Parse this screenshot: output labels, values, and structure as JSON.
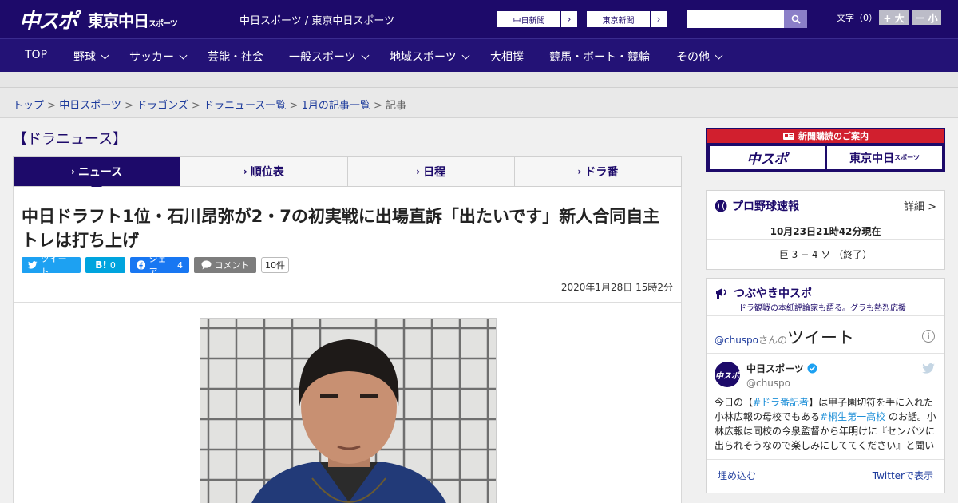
{
  "header": {
    "logo_primary": "中スポ",
    "logo_secondary": "東京中日",
    "logo_secondary_small": "スポーツ",
    "site_name": "中日スポーツ / 東京中日スポーツ",
    "ext_links": [
      {
        "label": "中日新聞"
      },
      {
        "label": "東京新聞"
      }
    ],
    "search_placeholder": "",
    "font_size_label": "文字（0）",
    "font_larger": "+ 大",
    "font_smaller": "ー 小"
  },
  "nav": [
    {
      "label": "TOP",
      "dropdown": false
    },
    {
      "label": "野球",
      "dropdown": true
    },
    {
      "label": "サッカー",
      "dropdown": true
    },
    {
      "label": "芸能・社会",
      "dropdown": false
    },
    {
      "label": "一般スポーツ",
      "dropdown": true
    },
    {
      "label": "地域スポーツ",
      "dropdown": true
    },
    {
      "label": "大相撲",
      "dropdown": false
    },
    {
      "label": "競馬・ボート・競輪",
      "dropdown": false
    },
    {
      "label": "その他",
      "dropdown": true
    }
  ],
  "breadcrumb": [
    {
      "label": "トップ"
    },
    {
      "label": "中日スポーツ"
    },
    {
      "label": "ドラゴンズ"
    },
    {
      "label": "ドラニュース一覧"
    },
    {
      "label": "1月の記事一覧"
    },
    {
      "label": "記事"
    }
  ],
  "section_title": "【ドラニュース】",
  "tabs": [
    {
      "label": "ニュース",
      "active": true
    },
    {
      "label": "順位表",
      "active": false
    },
    {
      "label": "日程",
      "active": false
    },
    {
      "label": "ドラ番",
      "active": false
    }
  ],
  "article": {
    "headline": "中日ドラフト1位・石川昂弥が2・7の初実戦に出場直訴「出たいです」新人合同自主トレは打ち上げ",
    "share": {
      "tweet": "ツイート",
      "hatena": "B!",
      "hatena_count": "0",
      "facebook": "シェア",
      "facebook_count": "4",
      "comment": "コメント",
      "comment_count": "10件"
    },
    "date": "2020年1月28日 15時2分"
  },
  "sidebar": {
    "ad_title": "新聞購読のご案内",
    "ad_left": "中スポ",
    "ad_right": "東京中日",
    "ad_right_small": "スポーツ",
    "baseball": {
      "title": "プロ野球速報",
      "detail": "詳細 >",
      "timestamp": "10月23日21時42分現在",
      "score": "巨 3 − 4 ソ （終了）"
    },
    "twitter": {
      "title": "つぶやき中スポ",
      "subtitle": "ドラ観戦の本紙評論家も語る。グラも熱烈応援",
      "handle_prefix": "@chuspo",
      "handle_mid": "さんの",
      "handle_suffix": "ツイート",
      "user_name": "中日スポーツ",
      "user_handle": "@chuspo",
      "avatar_text": "中スポ",
      "tweet_parts": [
        {
          "t": "今日の【",
          "h": false
        },
        {
          "t": "#ドラ番記者",
          "h": true
        },
        {
          "t": "】は甲子園切符を手に入れた小林広報の母校でもある",
          "h": false
        },
        {
          "t": "#桐生第一高校",
          "h": true
        },
        {
          "t": " のお話。小林広報は同校の今泉監督から年明けに『センバツに出られそうなので楽しみにしててください』と聞い",
          "h": false
        }
      ],
      "embed": "埋め込む",
      "view_on": "Twitterで表示"
    }
  }
}
